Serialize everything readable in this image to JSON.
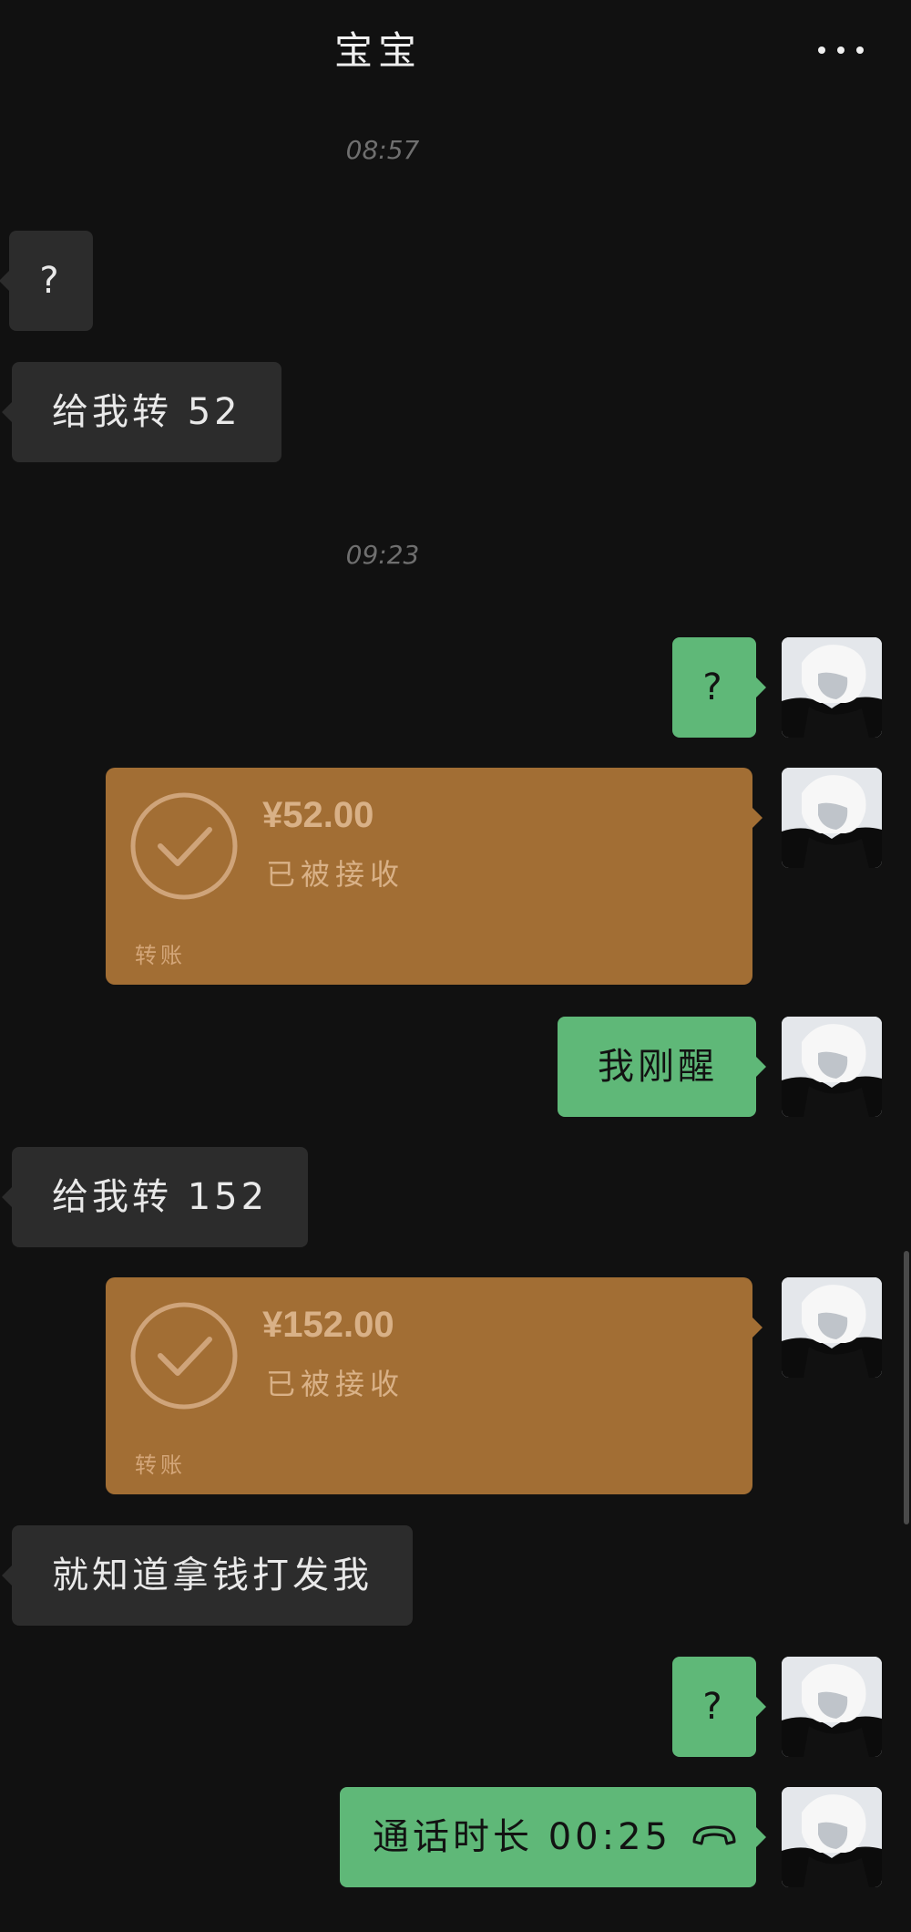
{
  "header": {
    "title": "宝宝"
  },
  "timestamps": [
    "08:57",
    "09:23"
  ],
  "messages": {
    "m1": "?",
    "m2": "给我转 52",
    "m3": "?",
    "m4": "我刚醒",
    "m5": "给我转 152",
    "m6": "就知道拿钱打发我",
    "m7": "?",
    "m8": "通话时长 00:25"
  },
  "transfers": [
    {
      "amount": "¥52.00",
      "status": "已被接收",
      "label": "转账"
    },
    {
      "amount": "¥152.00",
      "status": "已被接收",
      "label": "转账"
    }
  ],
  "colors": {
    "background": "#111111",
    "incoming_bubble": "#2c2c2c",
    "outgoing_bubble": "#5fb878",
    "transfer_card": "#a26e34"
  },
  "icons": {
    "menu": "more-horizontal-icon",
    "transfer": "check-circle-icon",
    "call": "phone-hangup-icon"
  }
}
